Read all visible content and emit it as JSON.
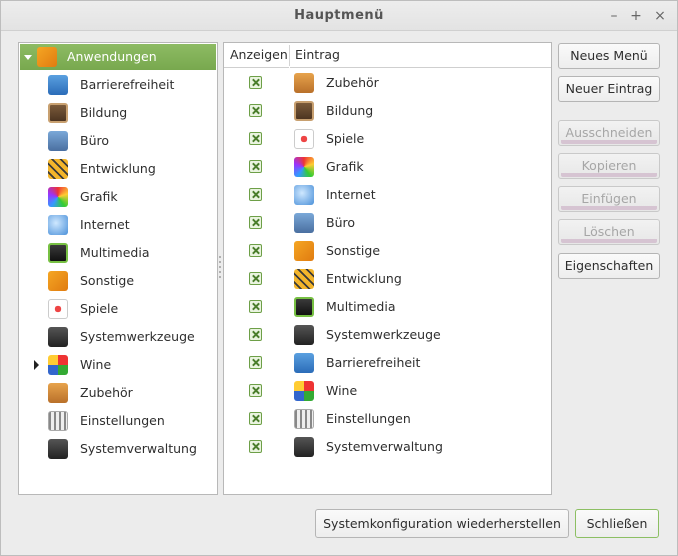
{
  "window": {
    "title": "Hauptmenü",
    "minimize": "–",
    "maximize": "+",
    "close": "×"
  },
  "colors": {
    "accent": "#80b157",
    "selection": "#80b157"
  },
  "tree": {
    "root": {
      "label": "Anwendungen",
      "icon": "categories-icon",
      "expanded": true,
      "selected": true
    },
    "items": [
      {
        "label": "Barrierefreiheit",
        "icon": "accessibility-icon"
      },
      {
        "label": "Bildung",
        "icon": "education-icon"
      },
      {
        "label": "Büro",
        "icon": "office-icon"
      },
      {
        "label": "Entwicklung",
        "icon": "development-icon"
      },
      {
        "label": "Grafik",
        "icon": "graphics-icon"
      },
      {
        "label": "Internet",
        "icon": "internet-icon"
      },
      {
        "label": "Multimedia",
        "icon": "multimedia-icon"
      },
      {
        "label": "Sonstige",
        "icon": "other-icon"
      },
      {
        "label": "Spiele",
        "icon": "games-icon"
      },
      {
        "label": "Systemwerkzeuge",
        "icon": "system-tools-icon"
      },
      {
        "label": "Wine",
        "icon": "wine-icon",
        "has_children": true
      },
      {
        "label": "Zubehör",
        "icon": "accessories-icon"
      },
      {
        "label": "Einstellungen",
        "icon": "settings-icon"
      },
      {
        "label": "Systemverwaltung",
        "icon": "administration-icon"
      }
    ]
  },
  "entries": {
    "headers": {
      "show": "Anzeigen",
      "entry": "Eintrag"
    },
    "rows": [
      {
        "label": "Zubehör",
        "icon": "accessories-icon",
        "checked": true
      },
      {
        "label": "Bildung",
        "icon": "education-icon",
        "checked": true
      },
      {
        "label": "Spiele",
        "icon": "games-icon",
        "checked": true
      },
      {
        "label": "Grafik",
        "icon": "graphics-icon",
        "checked": true
      },
      {
        "label": "Internet",
        "icon": "internet-icon",
        "checked": true
      },
      {
        "label": "Büro",
        "icon": "office-icon",
        "checked": true
      },
      {
        "label": "Sonstige",
        "icon": "other-icon",
        "checked": true
      },
      {
        "label": "Entwicklung",
        "icon": "development-icon",
        "checked": true
      },
      {
        "label": "Multimedia",
        "icon": "multimedia-icon",
        "checked": true
      },
      {
        "label": "Systemwerkzeuge",
        "icon": "system-tools-icon",
        "checked": true
      },
      {
        "label": "Barrierefreiheit",
        "icon": "accessibility-icon",
        "checked": true
      },
      {
        "label": "Wine",
        "icon": "wine-icon",
        "checked": true
      },
      {
        "label": "Einstellungen",
        "icon": "settings-icon",
        "checked": true
      },
      {
        "label": "Systemverwaltung",
        "icon": "administration-icon",
        "checked": true
      }
    ]
  },
  "buttons": {
    "new_menu": "Neues Menü",
    "new_entry": "Neuer Eintrag",
    "cut": "Ausschneiden",
    "copy": "Kopieren",
    "paste": "Einfügen",
    "delete": "Löschen",
    "properties": "Eigenschaften",
    "restore": "Systemkonfiguration wiederherstellen",
    "close": "Schließen"
  }
}
